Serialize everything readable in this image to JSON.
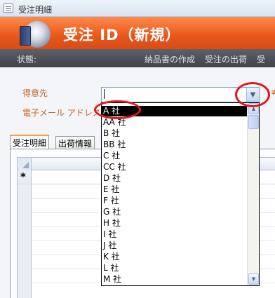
{
  "window": {
    "title": "受注明細"
  },
  "header": {
    "title": "受注 ID（新規）"
  },
  "toolbar": {
    "status": "状態:",
    "items": [
      "納品書の作成",
      "受注の出荷",
      "受"
    ]
  },
  "form": {
    "customer_label": "得意先",
    "email_label": "電子メール アドレス",
    "customer_value": ""
  },
  "tabs": [
    {
      "label": "受注明細"
    },
    {
      "label": "出荷情報"
    }
  ],
  "grid": {
    "new_record_marker": "*"
  },
  "dropdown": {
    "options": [
      "A 社",
      "AA 社",
      "B 社",
      "BB 社",
      "C 社",
      "CC 社",
      "D 社",
      "E 社",
      "F 社",
      "G 社",
      "H 社",
      "I 社",
      "J 社",
      "K 社",
      "L 社",
      "M 社"
    ],
    "selected_index": 0
  },
  "icons": {
    "combo_button": "chevron-down-icon",
    "scroll_up": "triangle-up-icon",
    "scroll_down": "chevron-down-icon"
  },
  "colors": {
    "header": "#e8571c",
    "label": "#c0652c",
    "annotation": "#e3171d"
  }
}
